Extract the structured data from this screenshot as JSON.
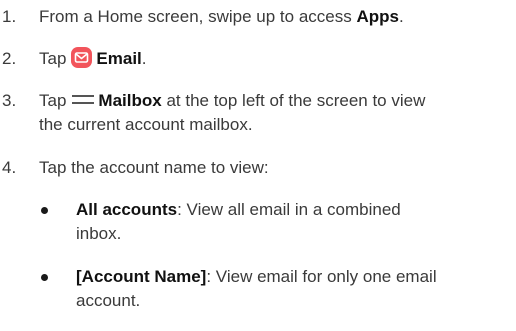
{
  "steps": [
    {
      "num": "1.",
      "pre": "From a Home screen, swipe up to access ",
      "bold": "Apps",
      "post": "."
    },
    {
      "num": "2.",
      "pre": "Tap",
      "icon": "email-app-icon",
      "bold": "Email",
      "post": "."
    },
    {
      "num": "3.",
      "pre": "Tap",
      "icon": "hamburger-menu-icon",
      "bold": "Mailbox",
      "post_line1": " at the top left of the screen to view",
      "post_line2": "the current account mailbox."
    },
    {
      "num": "4.",
      "text": "Tap the account name to view:"
    }
  ],
  "bullets": [
    {
      "bold": "All accounts",
      "line1": ": View all email in a combined",
      "line2": "inbox."
    },
    {
      "bold": "[Account Name]",
      "line1": ": View email for only one email",
      "line2": "account."
    }
  ],
  "colors": {
    "text": "#3a3a3a",
    "bold": "#111111",
    "email_icon_bg": "#f2545b"
  }
}
